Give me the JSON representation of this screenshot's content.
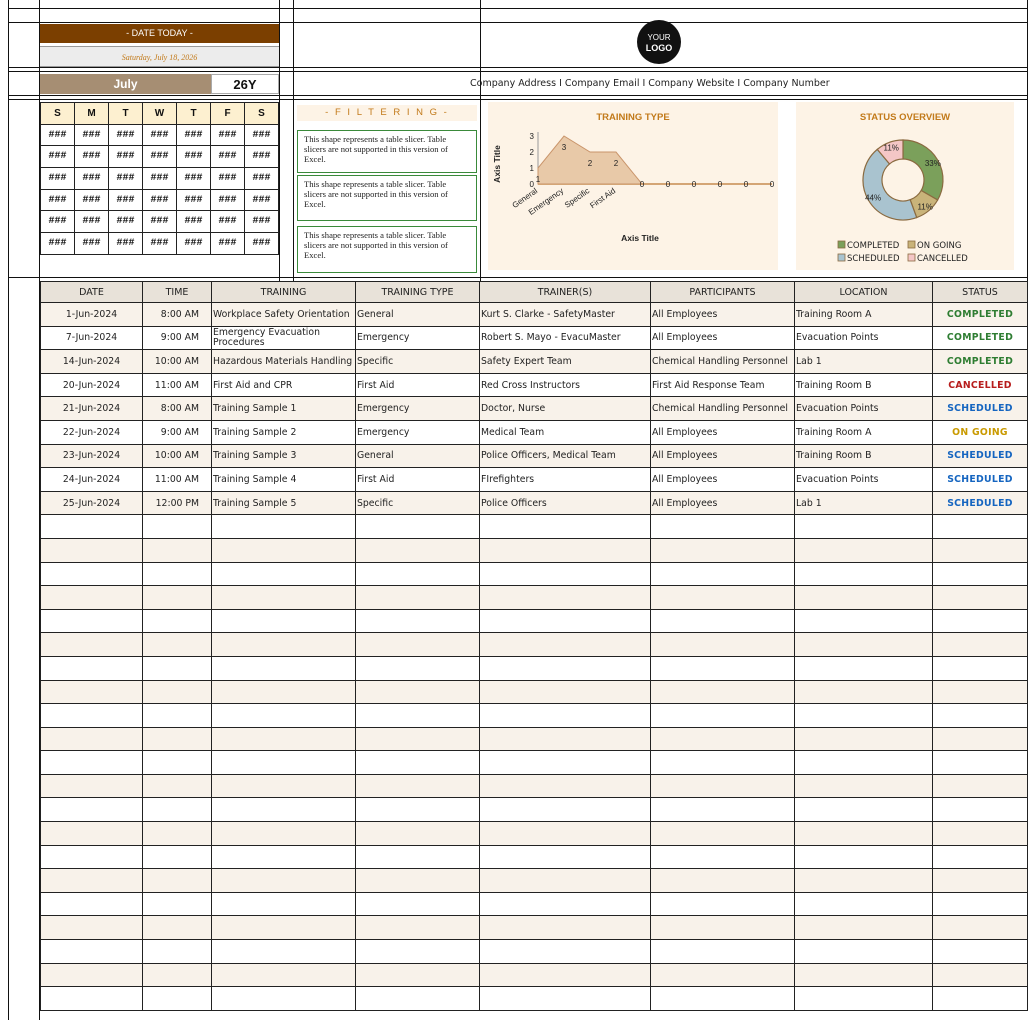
{
  "header": {
    "date_today_label": "- DATE TODAY -",
    "date_long": "Saturday, July 18, 2026",
    "month": "July",
    "year": "26Y",
    "logo_line1": "YOUR",
    "logo_line2": "LOGO",
    "company_line": "Company Address  I  Company Email  I  Company Website  I  Company Number"
  },
  "calendar": {
    "days": [
      "S",
      "M",
      "T",
      "W",
      "T",
      "F",
      "S"
    ],
    "cell": "###"
  },
  "filtering": {
    "title": "- F I L T E R I N G -",
    "slicer_text": "This shape represents a table slicer. Table slicers are not supported in this version of Excel."
  },
  "training_chart": {
    "title": "TRAINING TYPE",
    "xlabel": "Axis Title",
    "ylabel": "Axis Title"
  },
  "chart_data": [
    {
      "type": "area",
      "title": "TRAINING TYPE",
      "xlabel": "Axis Title",
      "ylabel": "Axis Title",
      "categories": [
        "General",
        "Emergency",
        "Specific",
        "First Aid",
        "",
        "",
        "",
        "",
        "",
        ""
      ],
      "values": [
        1,
        3,
        2,
        2,
        0,
        0,
        0,
        0,
        0,
        0
      ],
      "y_ticks": [
        "0",
        "1",
        "2",
        "3"
      ],
      "ylim": [
        0,
        3
      ]
    },
    {
      "type": "pie",
      "title": "STATUS OVERVIEW",
      "labels": [
        "COMPLETED",
        "ON GOING",
        "SCHEDULED",
        "CANCELLED"
      ],
      "values": [
        33,
        11,
        44,
        11
      ],
      "value_labels": [
        "33%",
        "11%",
        "44%",
        "11%"
      ],
      "colors": [
        "#7ba05b",
        "#c9b37a",
        "#a9c3cf",
        "#f4c6c6"
      ],
      "legend_position": "bottom"
    }
  ],
  "status_chart": {
    "title": "STATUS OVERVIEW",
    "legend": [
      "COMPLETED",
      "ON GOING",
      "SCHEDULED",
      "CANCELLED"
    ]
  },
  "table": {
    "headers": [
      "DATE",
      "TIME",
      "TRAINING",
      "TRAINING TYPE",
      "TRAINER(S)",
      "PARTICIPANTS",
      "LOCATION",
      "STATUS"
    ],
    "rows": [
      [
        "1-Jun-2024",
        "8:00 AM",
        "Workplace Safety Orientation",
        "General",
        "Kurt S. Clarke - SafetyMaster",
        "All Employees",
        "Training Room A",
        "COMPLETED"
      ],
      [
        "7-Jun-2024",
        "9:00 AM",
        "Emergency Evacuation Procedures",
        "Emergency",
        "Robert S. Mayo - EvacuMaster",
        "All Employees",
        "Evacuation Points",
        "COMPLETED"
      ],
      [
        "14-Jun-2024",
        "10:00 AM",
        "Hazardous Materials Handling",
        "Specific",
        "Safety Expert Team",
        "Chemical Handling Personnel",
        "Lab 1",
        "COMPLETED"
      ],
      [
        "20-Jun-2024",
        "11:00 AM",
        "First Aid and CPR",
        "First Aid",
        "Red Cross Instructors",
        "First Aid Response Team",
        "Training Room B",
        "CANCELLED"
      ],
      [
        "21-Jun-2024",
        "8:00 AM",
        "Training Sample 1",
        "Emergency",
        "Doctor, Nurse",
        "Chemical Handling Personnel",
        "Evacuation Points",
        "SCHEDULED"
      ],
      [
        "22-Jun-2024",
        "9:00 AM",
        "Training Sample 2",
        "Emergency",
        "Medical Team",
        "All Employees",
        "Training Room A",
        "ON GOING"
      ],
      [
        "23-Jun-2024",
        "10:00 AM",
        "Training Sample 3",
        "General",
        "Police Officers, Medical Team",
        "All Employees",
        "Training Room B",
        "SCHEDULED"
      ],
      [
        "24-Jun-2024",
        "11:00 AM",
        "Training Sample 4",
        "First Aid",
        "FIrefighters",
        "All Employees",
        "Evacuation Points",
        "SCHEDULED"
      ],
      [
        "25-Jun-2024",
        "12:00 PM",
        "Training Sample 5",
        "Specific",
        "Police Officers",
        "All Employees",
        "Lab 1",
        "SCHEDULED"
      ]
    ],
    "empty_rows": 21
  },
  "status_colors": {
    "COMPLETED": "#2e7d32",
    "CANCELLED": "#b71c1c",
    "SCHEDULED": "#1565c0",
    "ON GOING": "#c99a00"
  }
}
